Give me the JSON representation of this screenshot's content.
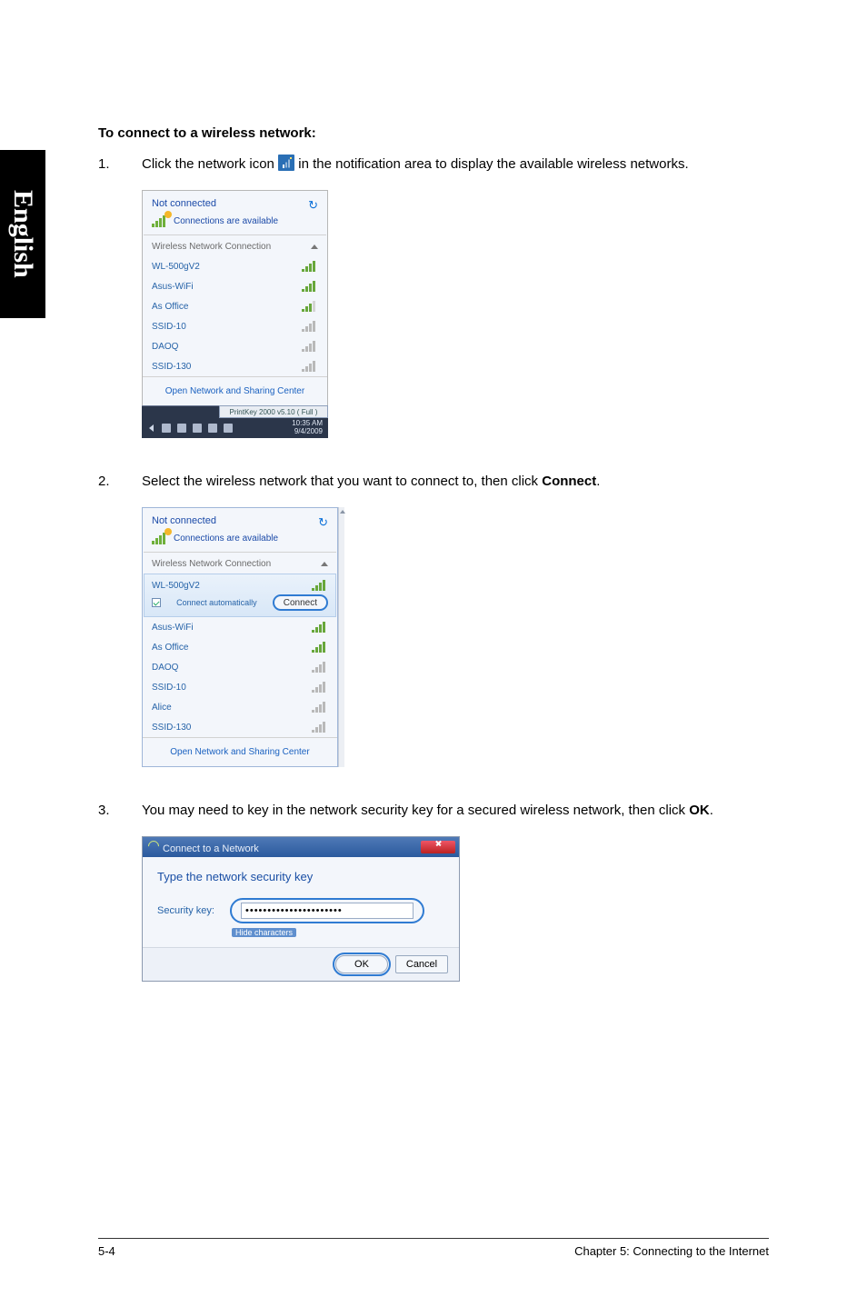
{
  "sideTab": "English",
  "heading": "To connect to a wireless network:",
  "steps": {
    "1": {
      "num": "1.",
      "pre": "Click the network icon ",
      "post": " in the notification area to display the available wireless networks."
    },
    "2": {
      "num": "2.",
      "text": "Select the wireless network that you want to connect to, then click ",
      "bold": "Connect",
      "post": "."
    },
    "3": {
      "num": "3.",
      "text": "You may need to key in the network security key for a secured wireless network, then click ",
      "bold": "OK",
      "post": "."
    }
  },
  "panel1": {
    "status": "Not connected",
    "avail": "Connections are available",
    "section": "Wireless Network Connection",
    "nets": [
      {
        "name": "WL-500gV2"
      },
      {
        "name": "Asus-WiFi"
      },
      {
        "name": "As Office"
      },
      {
        "name": "SSID-10"
      },
      {
        "name": "DAOQ"
      },
      {
        "name": "SSID-130"
      }
    ],
    "centerLink": "Open Network and Sharing Center",
    "trayBtn": "PrintKey 2000  v5.10 ( Full )",
    "time": "10:35 AM",
    "date": "9/4/2009"
  },
  "panel2": {
    "status": "Not connected",
    "avail": "Connections are available",
    "section": "Wireless Network Connection",
    "selected": {
      "name": "WL-500gV2",
      "auto": "Connect automatically",
      "btn": "Connect"
    },
    "nets": [
      {
        "name": "Asus-WiFi"
      },
      {
        "name": "As Office"
      },
      {
        "name": "DAOQ"
      },
      {
        "name": "SSID-10"
      },
      {
        "name": "Alice"
      },
      {
        "name": "SSID-130"
      }
    ],
    "centerLink": "Open Network and Sharing Center"
  },
  "dialog": {
    "title": "Connect to a Network",
    "prompt": "Type the network security key",
    "fieldLabel": "Security key:",
    "value": "••••••••••••••••••••••",
    "hide": "Hide characters",
    "ok": "OK",
    "cancel": "Cancel"
  },
  "footer": {
    "left": "5-4",
    "right": "Chapter 5: Connecting to the Internet"
  }
}
